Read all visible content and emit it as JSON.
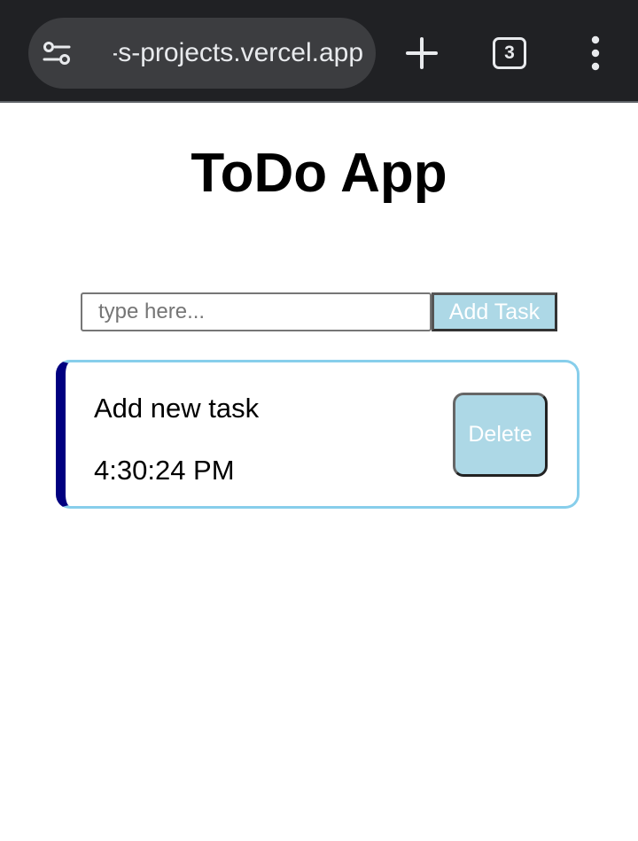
{
  "browser": {
    "url": "mrinal-s-projects.vercel.app",
    "tab_count": "3",
    "icons": {
      "site_settings": "site-settings-icon",
      "new_tab": "plus-icon",
      "menu": "more-vert-icon"
    }
  },
  "app": {
    "title": "ToDo App",
    "input": {
      "placeholder": "type here...",
      "value": ""
    },
    "add_button_label": "Add Task",
    "tasks": [
      {
        "text": "Add new task",
        "time": "4:30:24 PM",
        "delete_label": "Delete"
      }
    ]
  },
  "colors": {
    "chrome_bg": "#202124",
    "button_bg": "#add8e6",
    "card_border": "#87ceeb",
    "card_accent": "#000080"
  }
}
